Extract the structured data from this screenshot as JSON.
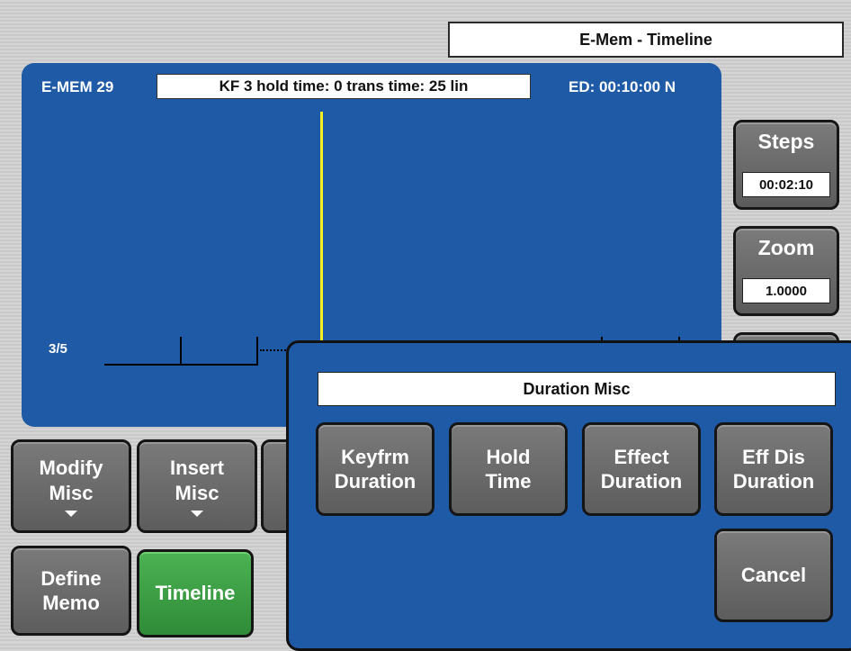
{
  "header": {
    "title": "E-Mem - Timeline"
  },
  "timeline": {
    "emem_label": "E-MEM 29",
    "keyframe_info": "KF 3 hold time: 0 trans time: 25 lin",
    "ed_label": "ED: 00:10:00 N",
    "track_label": "3/5",
    "cursor_color": "#f4ef22"
  },
  "side_controls": {
    "steps": {
      "label": "Steps",
      "value": "00:02:10"
    },
    "zoom": {
      "label": "Zoom",
      "value": "1.0000"
    }
  },
  "bottom_buttons": {
    "modify_misc": [
      "Modify",
      "Misc"
    ],
    "insert_misc": [
      "Insert",
      "Misc"
    ],
    "define_memo": [
      "Define",
      "Memo"
    ],
    "timeline": "Timeline"
  },
  "popup": {
    "title": "Duration Misc",
    "buttons": [
      {
        "line1": "Keyfrm",
        "line2": "Duration"
      },
      {
        "line1": "Hold",
        "line2": "Time"
      },
      {
        "line1": "Effect",
        "line2": "Duration"
      },
      {
        "line1": "Eff Dis",
        "line2": "Duration"
      }
    ],
    "cancel": "Cancel"
  },
  "colors": {
    "panel_blue": "#1e5aa6",
    "active_green": "#3a9a42",
    "button_gray": "#6a6a6a"
  }
}
